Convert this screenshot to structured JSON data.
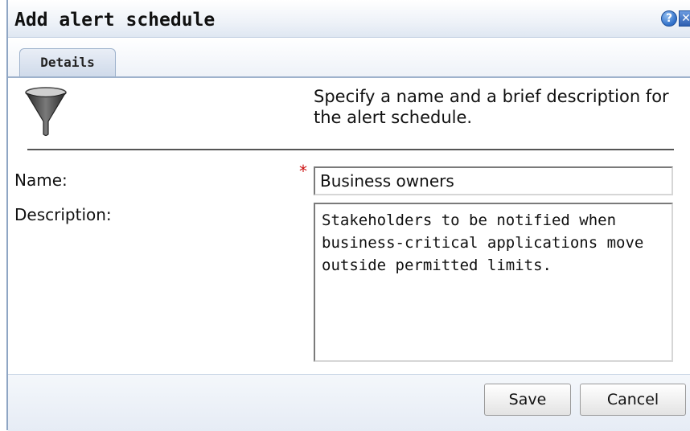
{
  "dialog": {
    "title": "Add alert schedule",
    "help_icon": "help-icon",
    "close_icon": "close-icon"
  },
  "tabs": [
    {
      "label": "Details",
      "selected": true
    }
  ],
  "details": {
    "icon": "filter-funnel-icon",
    "intro_text": "Specify a name and a brief description for the alert schedule.",
    "name_label": "Name:",
    "required_marker": "*",
    "name_value": "Business owners",
    "description_label": "Description:",
    "description_value": "Stakeholders to be notified when business-critical applications move outside permitted limits."
  },
  "buttons": {
    "save_label": "Save",
    "cancel_label": "Cancel"
  },
  "colors": {
    "required": "#cc1111",
    "accent": "#2f6fc8"
  }
}
